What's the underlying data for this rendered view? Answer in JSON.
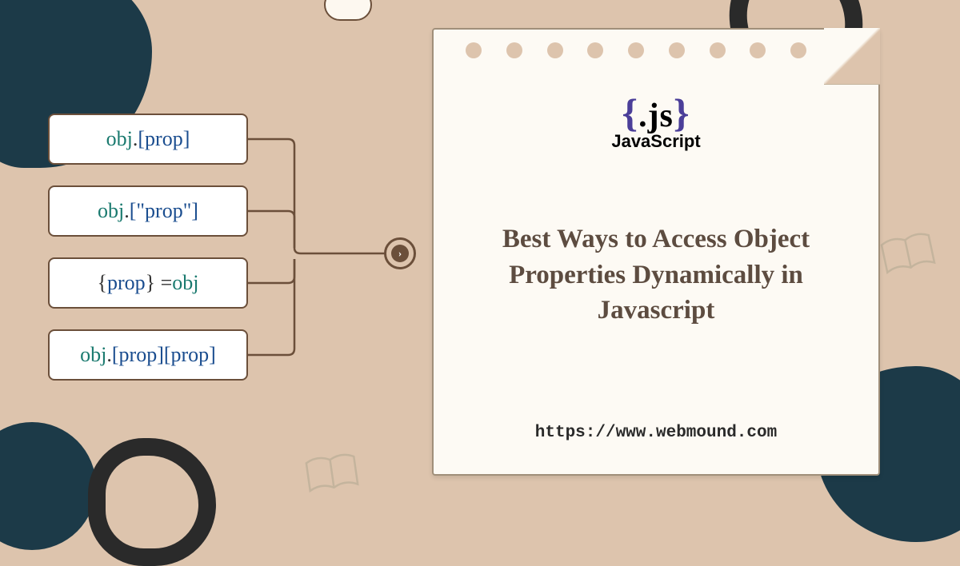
{
  "codeExamples": {
    "ex1": {
      "obj": "obj",
      "dot": ".",
      "rest": "[prop]"
    },
    "ex2": {
      "obj": "obj",
      "dot": ".",
      "rest": "[\"prop\"]"
    },
    "ex3": {
      "open": "{ ",
      "prop": "prop",
      "close": " } = ",
      "obj": "obj"
    },
    "ex4": {
      "obj": "obj",
      "dot": ".",
      "rest": "[prop][prop]"
    }
  },
  "logo": {
    "braceOpen": "{",
    "js": ".js",
    "braceClose": "}",
    "label": "JavaScript"
  },
  "title": "Best Ways to Access Object Properties Dynamically in Javascript",
  "url": "https://www.webmound.com",
  "arrow": "›"
}
